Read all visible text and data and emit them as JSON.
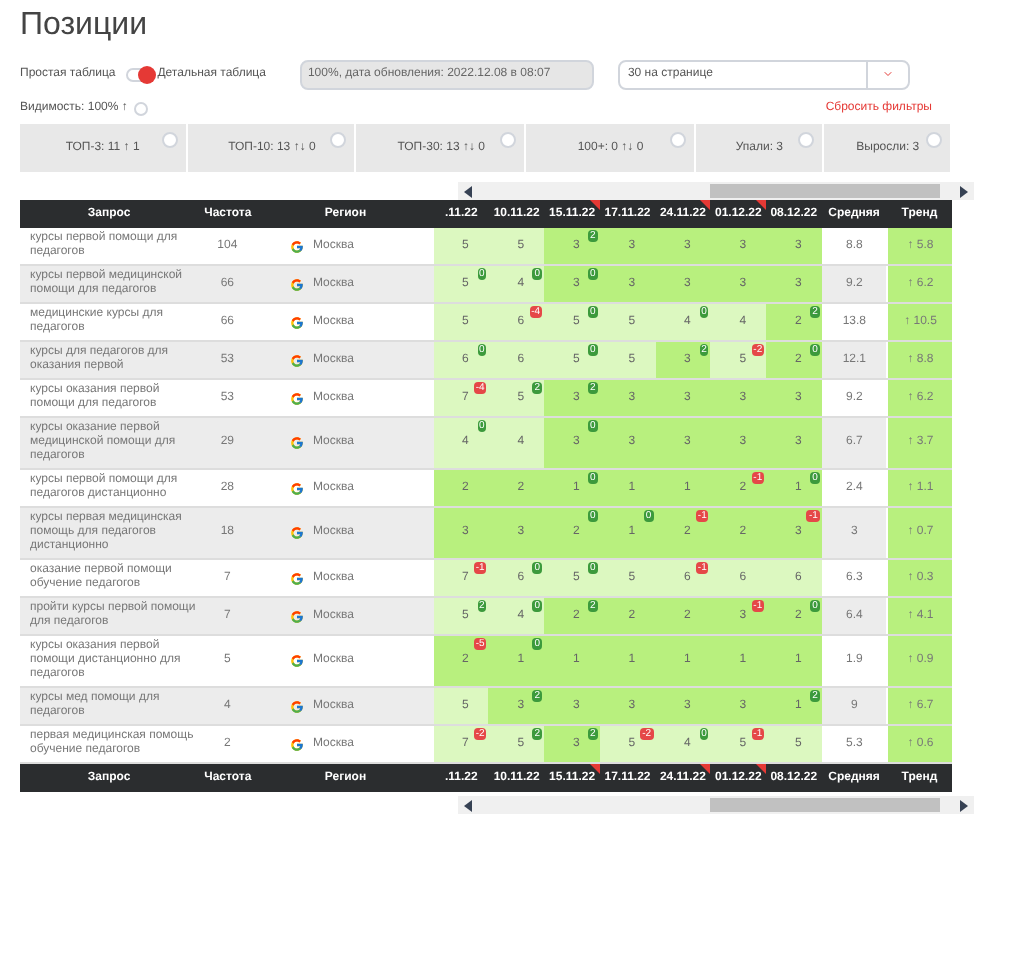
{
  "title": "Позиции",
  "view_toggle": {
    "left_label": "Простая таблица",
    "right_label": "Детальная таблица",
    "on": true
  },
  "update_info": {
    "value": "100%, дата обновления: 2022.12.08 в 08:07"
  },
  "per_page": {
    "value": "30 на странице"
  },
  "visibility": {
    "label": "Видимость: 100% ↑"
  },
  "reset_filters": "Сбросить фильтры",
  "stats": [
    "ТОП-3: 11 ↑ 1",
    "ТОП-10: 13 ↑↓ 0",
    "ТОП-30: 13 ↑↓ 0",
    "100+: 0 ↑↓ 0",
    "Упали: 3",
    "Выросли: 3"
  ],
  "table": {
    "columns": [
      "Запрос",
      "Частота",
      "Регион"
    ],
    "dates": [
      {
        "label": ".11.22",
        "flag": false
      },
      {
        "label": "10.11.22",
        "flag": false
      },
      {
        "label": "15.11.22",
        "flag": true
      },
      {
        "label": "17.11.22",
        "flag": false
      },
      {
        "label": "24.11.22",
        "flag": true
      },
      {
        "label": "01.12.22",
        "flag": true
      },
      {
        "label": "08.12.22",
        "flag": false
      }
    ],
    "tail_columns": [
      "Средняя",
      "Тренд"
    ],
    "rows": [
      {
        "query": "курсы первой помощи для педагогов",
        "frequency": "104",
        "region": "Москва",
        "cells": [
          {
            "v": "5",
            "top": false
          },
          {
            "v": "5",
            "top": false
          },
          {
            "v": "3",
            "top": true,
            "badge": {
              "text": "2",
              "kind": "up"
            }
          },
          {
            "v": "3",
            "top": true
          },
          {
            "v": "3",
            "top": true
          },
          {
            "v": "3",
            "top": true
          },
          {
            "v": "3",
            "top": true
          }
        ],
        "average": "8.8",
        "trend": "↑ 5.8"
      },
      {
        "query": "курсы первой медицинской помощи для педагогов",
        "frequency": "66",
        "region": "Москва",
        "cells": [
          {
            "v": "5",
            "top": false,
            "badge": {
              "text": "0",
              "kind": "up"
            }
          },
          {
            "v": "4",
            "top": false,
            "badge": {
              "text": "0",
              "kind": "up"
            }
          },
          {
            "v": "3",
            "top": true,
            "badge": {
              "text": "0",
              "kind": "up"
            }
          },
          {
            "v": "3",
            "top": true
          },
          {
            "v": "3",
            "top": true
          },
          {
            "v": "3",
            "top": true
          },
          {
            "v": "3",
            "top": true
          }
        ],
        "average": "9.2",
        "trend": "↑ 6.2"
      },
      {
        "query": "медицинские курсы для педагогов",
        "frequency": "66",
        "region": "Москва",
        "cells": [
          {
            "v": "5",
            "top": false
          },
          {
            "v": "6",
            "top": false,
            "badge": {
              "text": "-4",
              "kind": "down"
            }
          },
          {
            "v": "5",
            "top": false,
            "badge": {
              "text": "0",
              "kind": "up"
            }
          },
          {
            "v": "5",
            "top": false
          },
          {
            "v": "4",
            "top": false,
            "badge": {
              "text": "0",
              "kind": "up"
            }
          },
          {
            "v": "4",
            "top": false
          },
          {
            "v": "2",
            "top": true,
            "badge": {
              "text": "2",
              "kind": "up"
            }
          }
        ],
        "average": "13.8",
        "trend": "↑ 10.5"
      },
      {
        "query": "курсы для педагогов для оказания первой",
        "frequency": "53",
        "region": "Москва",
        "cells": [
          {
            "v": "6",
            "top": false,
            "badge": {
              "text": "0",
              "kind": "up"
            }
          },
          {
            "v": "6",
            "top": false
          },
          {
            "v": "5",
            "top": false,
            "badge": {
              "text": "0",
              "kind": "up"
            }
          },
          {
            "v": "5",
            "top": false
          },
          {
            "v": "3",
            "top": true,
            "badge": {
              "text": "2",
              "kind": "up"
            }
          },
          {
            "v": "5",
            "top": false,
            "badge": {
              "text": "-2",
              "kind": "down"
            }
          },
          {
            "v": "2",
            "top": true,
            "badge": {
              "text": "0",
              "kind": "up"
            }
          }
        ],
        "average": "12.1",
        "trend": "↑ 8.8"
      },
      {
        "query": "курсы оказания первой помощи для педагогов",
        "frequency": "53",
        "region": "Москва",
        "cells": [
          {
            "v": "7",
            "top": false,
            "badge": {
              "text": "-4",
              "kind": "down"
            }
          },
          {
            "v": "5",
            "top": false,
            "badge": {
              "text": "2",
              "kind": "up"
            }
          },
          {
            "v": "3",
            "top": true,
            "badge": {
              "text": "2",
              "kind": "up"
            }
          },
          {
            "v": "3",
            "top": true
          },
          {
            "v": "3",
            "top": true
          },
          {
            "v": "3",
            "top": true
          },
          {
            "v": "3",
            "top": true
          }
        ],
        "average": "9.2",
        "trend": "↑ 6.2"
      },
      {
        "query": "курсы оказание первой медицинской помощи для педагогов",
        "frequency": "29",
        "region": "Москва",
        "cells": [
          {
            "v": "4",
            "top": false,
            "badge": {
              "text": "0",
              "kind": "up"
            }
          },
          {
            "v": "4",
            "top": false
          },
          {
            "v": "3",
            "top": true,
            "badge": {
              "text": "0",
              "kind": "up"
            }
          },
          {
            "v": "3",
            "top": true
          },
          {
            "v": "3",
            "top": true
          },
          {
            "v": "3",
            "top": true
          },
          {
            "v": "3",
            "top": true
          }
        ],
        "average": "6.7",
        "trend": "↑ 3.7"
      },
      {
        "query": "курсы первой помощи для педагогов дистанционно",
        "frequency": "28",
        "region": "Москва",
        "cells": [
          {
            "v": "2",
            "top": true
          },
          {
            "v": "2",
            "top": true
          },
          {
            "v": "1",
            "top": true,
            "badge": {
              "text": "0",
              "kind": "up"
            }
          },
          {
            "v": "1",
            "top": true
          },
          {
            "v": "1",
            "top": true
          },
          {
            "v": "2",
            "top": true,
            "badge": {
              "text": "-1",
              "kind": "down"
            }
          },
          {
            "v": "1",
            "top": true,
            "badge": {
              "text": "0",
              "kind": "up"
            }
          }
        ],
        "average": "2.4",
        "trend": "↑ 1.1"
      },
      {
        "query": "курсы первая медицинская помощь для педагогов дистанционно",
        "frequency": "18",
        "region": "Москва",
        "cells": [
          {
            "v": "3",
            "top": true
          },
          {
            "v": "3",
            "top": true
          },
          {
            "v": "2",
            "top": true,
            "badge": {
              "text": "0",
              "kind": "up"
            }
          },
          {
            "v": "1",
            "top": true,
            "badge": {
              "text": "0",
              "kind": "up"
            }
          },
          {
            "v": "2",
            "top": true,
            "badge": {
              "text": "-1",
              "kind": "down"
            }
          },
          {
            "v": "2",
            "top": true
          },
          {
            "v": "3",
            "top": true,
            "badge": {
              "text": "-1",
              "kind": "down"
            }
          }
        ],
        "average": "3",
        "trend": "↑ 0.7"
      },
      {
        "query": "оказание первой помощи обучение педагогов",
        "frequency": "7",
        "region": "Москва",
        "cells": [
          {
            "v": "7",
            "top": false,
            "badge": {
              "text": "-1",
              "kind": "down"
            }
          },
          {
            "v": "6",
            "top": false,
            "badge": {
              "text": "0",
              "kind": "up"
            }
          },
          {
            "v": "5",
            "top": false,
            "badge": {
              "text": "0",
              "kind": "up"
            }
          },
          {
            "v": "5",
            "top": false
          },
          {
            "v": "6",
            "top": false,
            "badge": {
              "text": "-1",
              "kind": "down"
            }
          },
          {
            "v": "6",
            "top": false
          },
          {
            "v": "6",
            "top": false
          }
        ],
        "average": "6.3",
        "trend": "↑ 0.3"
      },
      {
        "query": "пройти курсы первой помощи для педагогов",
        "frequency": "7",
        "region": "Москва",
        "cells": [
          {
            "v": "5",
            "top": false,
            "badge": {
              "text": "2",
              "kind": "up"
            }
          },
          {
            "v": "4",
            "top": false,
            "badge": {
              "text": "0",
              "kind": "up"
            }
          },
          {
            "v": "2",
            "top": true,
            "badge": {
              "text": "2",
              "kind": "up"
            }
          },
          {
            "v": "2",
            "top": true
          },
          {
            "v": "2",
            "top": true
          },
          {
            "v": "3",
            "top": true,
            "badge": {
              "text": "-1",
              "kind": "down"
            }
          },
          {
            "v": "2",
            "top": true,
            "badge": {
              "text": "0",
              "kind": "up"
            }
          }
        ],
        "average": "6.4",
        "trend": "↑ 4.1"
      },
      {
        "query": "курсы оказания первой помощи дистанционно для педагогов",
        "frequency": "5",
        "region": "Москва",
        "cells": [
          {
            "v": "2",
            "top": true,
            "badge": {
              "text": "-5",
              "kind": "down"
            }
          },
          {
            "v": "1",
            "top": true,
            "badge": {
              "text": "0",
              "kind": "up"
            }
          },
          {
            "v": "1",
            "top": true
          },
          {
            "v": "1",
            "top": true
          },
          {
            "v": "1",
            "top": true
          },
          {
            "v": "1",
            "top": true
          },
          {
            "v": "1",
            "top": true
          }
        ],
        "average": "1.9",
        "trend": "↑ 0.9"
      },
      {
        "query": "курсы мед помощи для педагогов",
        "frequency": "4",
        "region": "Москва",
        "cells": [
          {
            "v": "5",
            "top": false
          },
          {
            "v": "3",
            "top": true,
            "badge": {
              "text": "2",
              "kind": "up"
            }
          },
          {
            "v": "3",
            "top": true
          },
          {
            "v": "3",
            "top": true
          },
          {
            "v": "3",
            "top": true
          },
          {
            "v": "3",
            "top": true
          },
          {
            "v": "1",
            "top": true,
            "badge": {
              "text": "2",
              "kind": "up"
            }
          }
        ],
        "average": "9",
        "trend": "↑ 6.7"
      },
      {
        "query": "первая медицинская помощь обучение педагогов",
        "frequency": "2",
        "region": "Москва",
        "cells": [
          {
            "v": "7",
            "top": false,
            "badge": {
              "text": "-2",
              "kind": "down"
            }
          },
          {
            "v": "5",
            "top": false,
            "badge": {
              "text": "2",
              "kind": "up"
            }
          },
          {
            "v": "3",
            "top": true,
            "badge": {
              "text": "2",
              "kind": "up"
            }
          },
          {
            "v": "5",
            "top": false,
            "badge": {
              "text": "-2",
              "kind": "down"
            }
          },
          {
            "v": "4",
            "top": false,
            "badge": {
              "text": "0",
              "kind": "up"
            }
          },
          {
            "v": "5",
            "top": false,
            "badge": {
              "text": "-1",
              "kind": "down"
            }
          },
          {
            "v": "5",
            "top": false
          }
        ],
        "average": "5.3",
        "trend": "↑ 0.6"
      }
    ],
    "footer": {
      "columns": [
        "Запрос",
        "Частота",
        "Регион"
      ],
      "dates": [
        {
          "label": ".11.22",
          "flag": false
        },
        {
          "label": "10.11.22",
          "flag": false
        },
        {
          "label": "15.11.22",
          "flag": true
        },
        {
          "label": "17.11.22",
          "flag": false
        },
        {
          "label": "24.11.22",
          "flag": true
        },
        {
          "label": "01.12.22",
          "flag": true
        },
        {
          "label": "08.12.22",
          "flag": false
        }
      ],
      "tail_columns": [
        "Средняя",
        "Тренд"
      ]
    }
  }
}
